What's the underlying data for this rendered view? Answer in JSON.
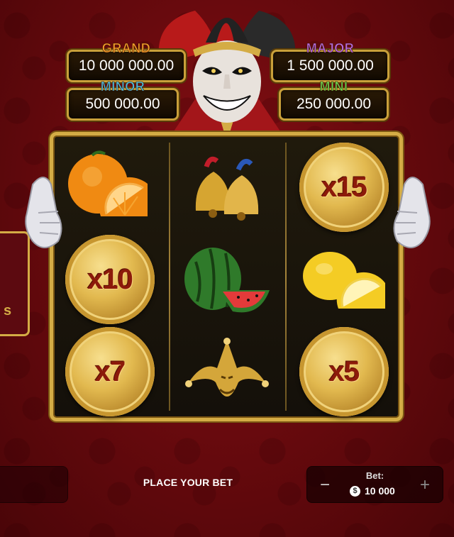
{
  "jackpots": {
    "grand": {
      "label": "GRAND",
      "value": "10 000 000.00"
    },
    "major": {
      "label": "MAJOR",
      "value": "1 500 000.00"
    },
    "minor": {
      "label": "MINOR",
      "value": "500 000.00"
    },
    "mini": {
      "label": "MINI",
      "value": "250 000.00"
    }
  },
  "reels": [
    [
      "orange",
      "coin",
      "coin"
    ],
    [
      "bells",
      "watermelon",
      "jester-mask"
    ],
    [
      "coin",
      "lemon",
      "coin"
    ]
  ],
  "multipliers": {
    "r1c2": "x10",
    "r1c3": "x7",
    "r3c1": "x15",
    "r3c3": "x5"
  },
  "side_panel": {
    "text": "s"
  },
  "bottom": {
    "place_bet": "PLACE YOUR BET",
    "bet_label": "Bet:",
    "bet_value": "10 000",
    "currency_icon": "$",
    "minus": "−",
    "plus": "+"
  },
  "colors": {
    "background": "#6a0a0e",
    "gold": "#d4ac45",
    "grand": "#f39a2a",
    "major": "#b86adf",
    "minor": "#4fb8d9",
    "mini": "#6ed04d"
  }
}
